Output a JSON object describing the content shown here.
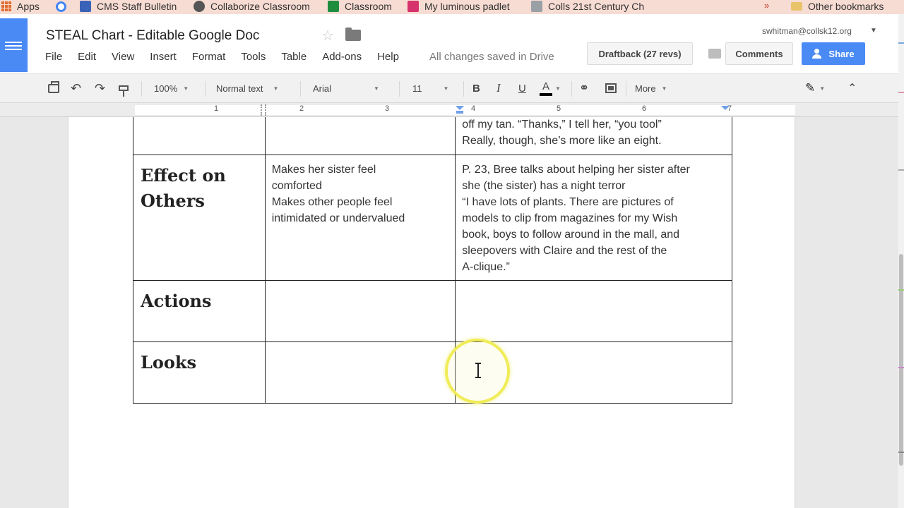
{
  "bookmarks": {
    "items": [
      {
        "label": "Apps"
      },
      {
        "label": ""
      },
      {
        "label": "CMS Staff Bulletin"
      },
      {
        "label": "Collaborize Classroom"
      },
      {
        "label": "Classroom"
      },
      {
        "label": "My luminous padlet"
      },
      {
        "label": "Colls 21st Century Ch"
      }
    ],
    "more": "»",
    "other": "Other bookmarks"
  },
  "header": {
    "title": "STEAL Chart - Editable Google Doc",
    "account": "swhitman@collsk12.org",
    "saved_status": "All changes saved in Drive",
    "draftback": "Draftback (27 revs)",
    "comments": "Comments",
    "share": "Share"
  },
  "menu": [
    "File",
    "Edit",
    "View",
    "Insert",
    "Format",
    "Tools",
    "Table",
    "Add-ons",
    "Help"
  ],
  "toolbar": {
    "zoom": "100%",
    "style": "Normal text",
    "font": "Arial",
    "size": "11",
    "bold": "B",
    "italic": "I",
    "underline": "U",
    "text_color": "A",
    "more": "More"
  },
  "ruler": [
    "1",
    "2",
    "3",
    "4",
    "5",
    "6",
    "7"
  ],
  "table": {
    "rows": [
      {
        "label": "",
        "col2": [],
        "col3": [
          "off my tan.  “Thanks,” I tell her, “you tool”",
          "Really, though, she’s more like an eight."
        ]
      },
      {
        "label": [
          "Effect on",
          "Others"
        ],
        "col2": [
          "Makes her sister feel",
          "comforted",
          "Makes other people feel",
          "intimidated or undervalued"
        ],
        "col3": [
          "P. 23, Bree talks about helping her sister after",
          "she (the sister) has a night terror",
          "“I have lots of plants.  There are pictures of",
          "models to clip from magazines for my Wish",
          "book, boys to follow around in the mall, and",
          "sleepovers with Claire and the rest of the",
          "A-clique.”"
        ]
      },
      {
        "label": [
          "Actions"
        ],
        "col2": [],
        "col3": []
      },
      {
        "label": [
          "Looks"
        ],
        "col2": [],
        "col3": []
      }
    ]
  },
  "colors": {
    "accent": "#4a8af4",
    "highlight": "#f0ec57"
  }
}
